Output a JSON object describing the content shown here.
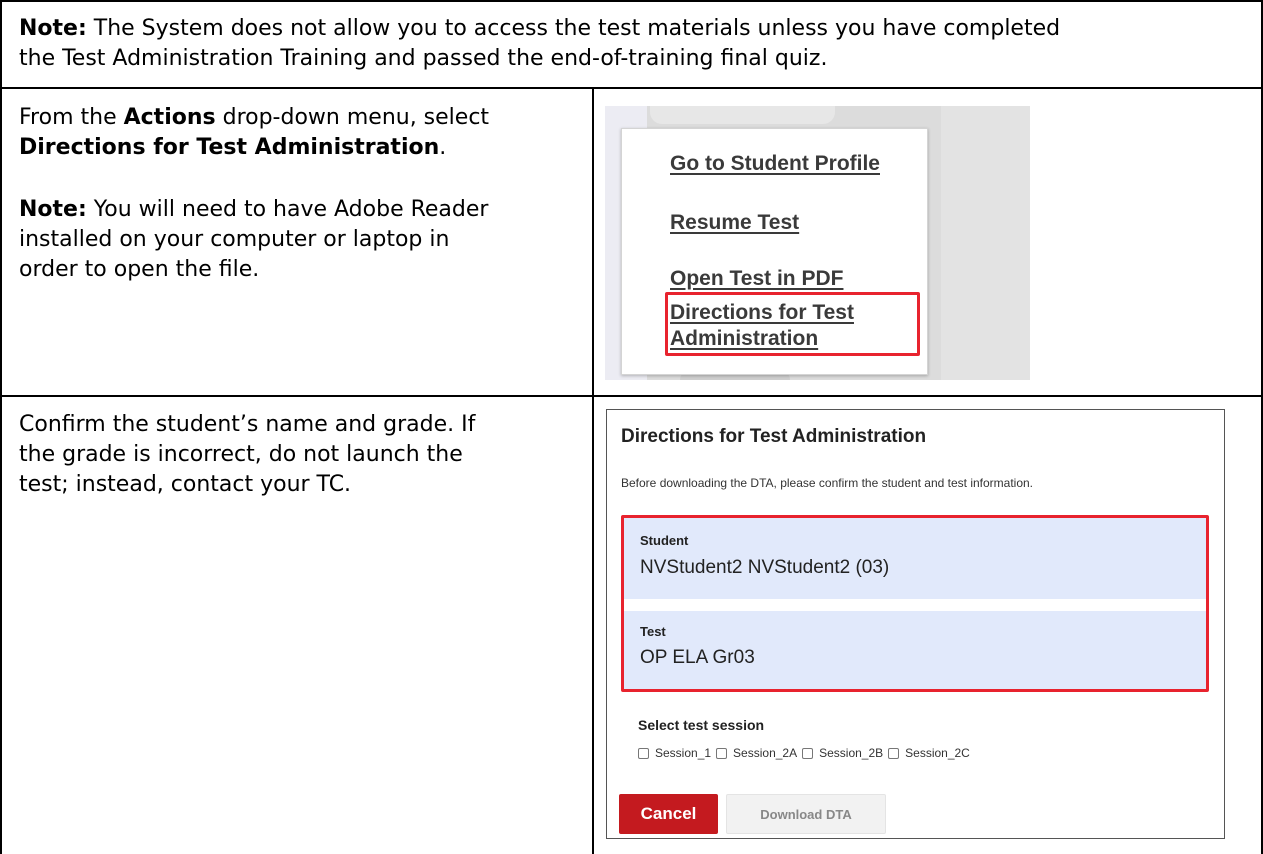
{
  "top_note": {
    "label": "Note:",
    "line1": " The System does not allow you to access the test materials unless you have completed",
    "line2": "the Test Administration Training and passed the end-of-training final quiz."
  },
  "step1": {
    "line1_pre": "From the ",
    "line1_bold": "Actions",
    "line1_post": " drop-down menu, select",
    "line2_bold": "Directions for Test Administration",
    "line2_post": ".",
    "note_label": "Note:",
    "note_line1": " You will need to have Adobe Reader",
    "note_line2": "installed on your computer or laptop in",
    "note_line3": "order to open the file."
  },
  "actions_menu": {
    "items": [
      "Go to Student Profile",
      "Resume Test",
      "Open Test in PDF",
      "Directions for Test",
      "Administration"
    ],
    "highlight_color": "#e8232e"
  },
  "step2": {
    "line1": "Confirm the student’s name and grade. If",
    "line2": "the grade is incorrect, do not launch the",
    "line3": "test; instead, contact your TC."
  },
  "dta_dialog": {
    "title": "Directions for Test Administration",
    "description": "Before downloading the DTA, please confirm the student and test information.",
    "student_label": "Student",
    "student_value": "NVStudent2 NVStudent2 (03)",
    "test_label": "Test",
    "test_value": "OP ELA Gr03",
    "session_label": "Select test session",
    "sessions": [
      "Session_1",
      "Session_2A",
      "Session_2B",
      "Session_2C"
    ],
    "cancel_label": "Cancel",
    "download_label": "Download DTA",
    "highlight_color": "#e8232e",
    "cancel_color": "#c41a1f"
  }
}
